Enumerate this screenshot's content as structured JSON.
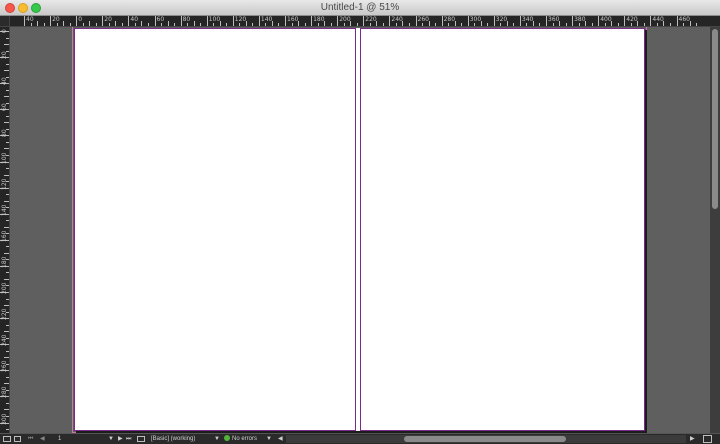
{
  "window": {
    "title": "Untitled-1 @ 51%"
  },
  "rulers": {
    "horizontal_labels": [
      "40",
      "20",
      "0",
      "20",
      "40",
      "60",
      "80",
      "100",
      "120",
      "140",
      "160",
      "180",
      "200",
      "220",
      "240",
      "260",
      "280",
      "300",
      "320",
      "340",
      "360",
      "380",
      "400",
      "420",
      "440",
      "460"
    ],
    "vertical_labels": [
      "0",
      "20",
      "40",
      "60",
      "80",
      "100",
      "120",
      "140",
      "160",
      "180",
      "200",
      "220",
      "240",
      "260",
      "280",
      "300"
    ]
  },
  "status": {
    "page_number": "1",
    "preflight_profile": "[Basic] (working)",
    "errors": "No errors"
  },
  "colors": {
    "pasteboard": "#5f5f5f",
    "ruler": "#252525",
    "page_edge": "#7a2b8a",
    "bleed": "#c87aa6",
    "no_errors_dot": "#53b33a"
  }
}
